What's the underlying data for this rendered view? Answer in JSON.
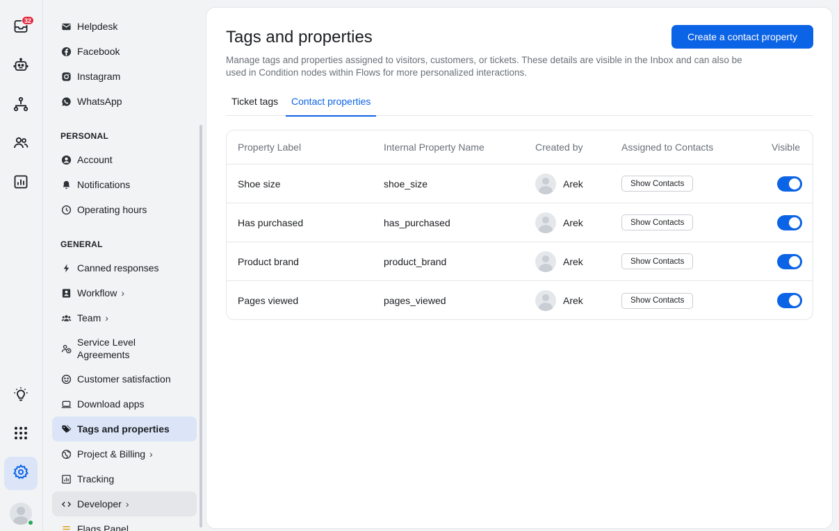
{
  "rail": {
    "inbox_badge": "32"
  },
  "nav": {
    "channels": [
      {
        "label": "Helpdesk",
        "icon": "mail-icon"
      },
      {
        "label": "Facebook",
        "icon": "facebook-icon"
      },
      {
        "label": "Instagram",
        "icon": "instagram-icon"
      },
      {
        "label": "WhatsApp",
        "icon": "whatsapp-icon"
      }
    ],
    "personal_heading": "PERSONAL",
    "personal": [
      {
        "label": "Account",
        "icon": "account-icon"
      },
      {
        "label": "Notifications",
        "icon": "bell-icon"
      },
      {
        "label": "Operating hours",
        "icon": "clock-icon"
      }
    ],
    "general_heading": "GENERAL",
    "general": [
      {
        "label": "Canned responses",
        "icon": "bolt-icon"
      },
      {
        "label": "Workflow",
        "icon": "workflow-icon",
        "chevron": "›"
      },
      {
        "label": "Team",
        "icon": "team-icon",
        "chevron": "›"
      },
      {
        "label": "Service Level Agreements",
        "icon": "sla-icon"
      },
      {
        "label": "Customer satisfaction",
        "icon": "smiley-icon"
      },
      {
        "label": "Download apps",
        "icon": "laptop-icon"
      },
      {
        "label": "Tags and properties",
        "icon": "tag-icon"
      },
      {
        "label": "Project & Billing",
        "icon": "globe-icon",
        "chevron": "›"
      },
      {
        "label": "Tracking",
        "icon": "chart-icon"
      },
      {
        "label": "Developer",
        "icon": "code-icon",
        "chevron": "›"
      },
      {
        "label": "Flags Panel",
        "icon": "flags-icon"
      }
    ]
  },
  "page": {
    "title": "Tags and properties",
    "description": "Manage tags and properties assigned to visitors, customers, or tickets. These details are visible in the Inbox and can also be used in Condition nodes within Flows for more personalized interactions.",
    "create_button": "Create a contact property",
    "tabs": [
      "Ticket tags",
      "Contact properties"
    ],
    "active_tab": "Contact properties"
  },
  "table": {
    "headers": [
      "Property Label",
      "Internal Property Name",
      "Created by",
      "Assigned to Contacts",
      "Visible"
    ],
    "rows": [
      {
        "label": "Shoe size",
        "internal": "shoe_size",
        "created_by": "Arek",
        "action": "Show Contacts",
        "visible": true
      },
      {
        "label": "Has purchased",
        "internal": "has_purchased",
        "created_by": "Arek",
        "action": "Show Contacts",
        "visible": true
      },
      {
        "label": "Product brand",
        "internal": "product_brand",
        "created_by": "Arek",
        "action": "Show Contacts",
        "visible": true
      },
      {
        "label": "Pages viewed",
        "internal": "pages_viewed",
        "created_by": "Arek",
        "action": "Show Contacts",
        "visible": true
      }
    ]
  },
  "colors": {
    "accent": "#0b63e5",
    "badge": "#e22b40",
    "selected_nav": "#dbe5f7",
    "online": "#27a957"
  }
}
